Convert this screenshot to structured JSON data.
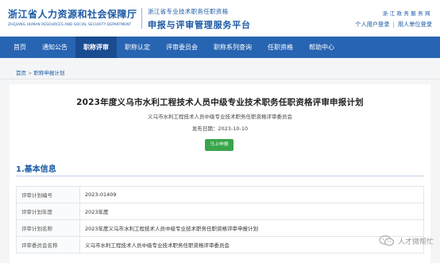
{
  "header": {
    "org_name_cn": "浙江省人力资源和社会保障厅",
    "org_name_en": "ZHEJIANG HUMAN RESOURCES AND SOCIAL SECURITY DEPARTMENT",
    "platform_sub": "浙江省专业技术职务任职资格",
    "platform_main": "申报与评审管理服务平台",
    "slogan": "浙江政务服务网",
    "personal_login": "个人用户登录",
    "unit_login": "用人单位登录",
    "link_separator": "|"
  },
  "nav": {
    "items": [
      {
        "label": "首页"
      },
      {
        "label": "通知公告"
      },
      {
        "label": "职称评审"
      },
      {
        "label": "职称认定"
      },
      {
        "label": "评审委员会"
      },
      {
        "label": "职称系列查询"
      },
      {
        "label": "任职资格"
      },
      {
        "label": "帮助中心"
      }
    ],
    "active_index": 2
  },
  "breadcrumb": {
    "home": "首页",
    "separator": ">",
    "current": "职称申报计划"
  },
  "plan": {
    "title": "2023年度义乌市水利工程技术人员中级专业技术职务任职资格评审申报计划",
    "issuer": "义乌市水利工程技术人员中级专业技术职务任职资格评审委员会",
    "publish_date": "发布日期：2023-10-10",
    "apply_button": "马上申报"
  },
  "basic_info": {
    "section_title": "1.基本信息",
    "rows": [
      {
        "key": "评审计划编号",
        "value": "2023-01409"
      },
      {
        "key": "评审计划年度",
        "value": "2023年度"
      },
      {
        "key": "评审计划名称",
        "value": "2023年度义乌市水利工程技术人员中级专业技术职务任职资格评审申报计划"
      },
      {
        "key": "评审委员会名称",
        "value": "义乌市水利工程技术人员中级专业技术职务任职资格评审委员会"
      }
    ]
  },
  "watermark": {
    "text": "人才微帮忙",
    "icon": "wechat-icon"
  },
  "colors": {
    "brand_blue": "#1a5aa6",
    "nav_bg": "#2764b2",
    "nav_active_bg": "#1a4c91",
    "apply_green": "#3aa54a"
  }
}
